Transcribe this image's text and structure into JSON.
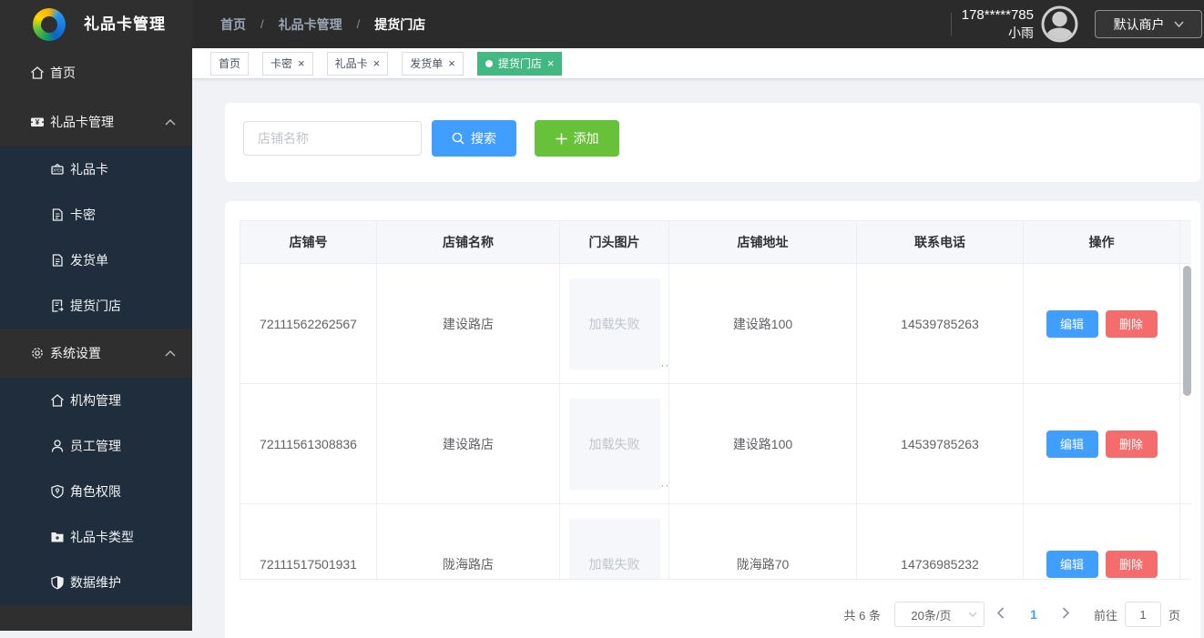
{
  "brand": {
    "title": "礼品卡管理"
  },
  "breadcrumb": {
    "separator": "/",
    "items": [
      "首页",
      "礼品卡管理",
      "提货门店"
    ]
  },
  "user": {
    "phone": "178*****785",
    "name": "小雨",
    "merchant_label": "默认商户"
  },
  "sidebar": {
    "home": "首页",
    "giftcard_mgmt": "礼品卡管理",
    "giftcard_children": [
      "礼品卡",
      "卡密",
      "发货单",
      "提货门店"
    ],
    "system": "系统设置",
    "system_children": [
      "机构管理",
      "员工管理",
      "角色权限",
      "礼品卡类型",
      "数据维护"
    ]
  },
  "tags": [
    "首页",
    "卡密",
    "礼品卡",
    "发货单",
    "提货门店"
  ],
  "search": {
    "placeholder": "店铺名称",
    "search_label": "搜索",
    "add_label": "添加"
  },
  "table": {
    "columns": [
      "店铺号",
      "店铺名称",
      "门头图片",
      "店铺地址",
      "联系电话",
      "操作"
    ],
    "image_placeholder": "加载失败",
    "edit_label": "编辑",
    "delete_label": "删除",
    "rows": [
      {
        "shop_no": "72111562262567",
        "name": "建设路店",
        "address": "建设路100",
        "phone": "14539785263"
      },
      {
        "shop_no": "72111561308836",
        "name": "建设路店",
        "address": "建设路100",
        "phone": "14539785263"
      },
      {
        "shop_no": "72111517501931",
        "name": "陇海路店",
        "address": "陇海路70",
        "phone": "14736985232"
      }
    ]
  },
  "pagination": {
    "total_text": "共 6 条",
    "page_size": "20条/页",
    "current_page": "1",
    "goto_label": "前往",
    "goto_value": "1",
    "page_label": "页"
  },
  "colors": {
    "primary": "#409eff",
    "success": "#67c23a",
    "danger": "#f56c6c",
    "tag_active": "#42b983",
    "header_bg": "#2b2b2b",
    "submenu_bg": "#1f2d3d"
  }
}
